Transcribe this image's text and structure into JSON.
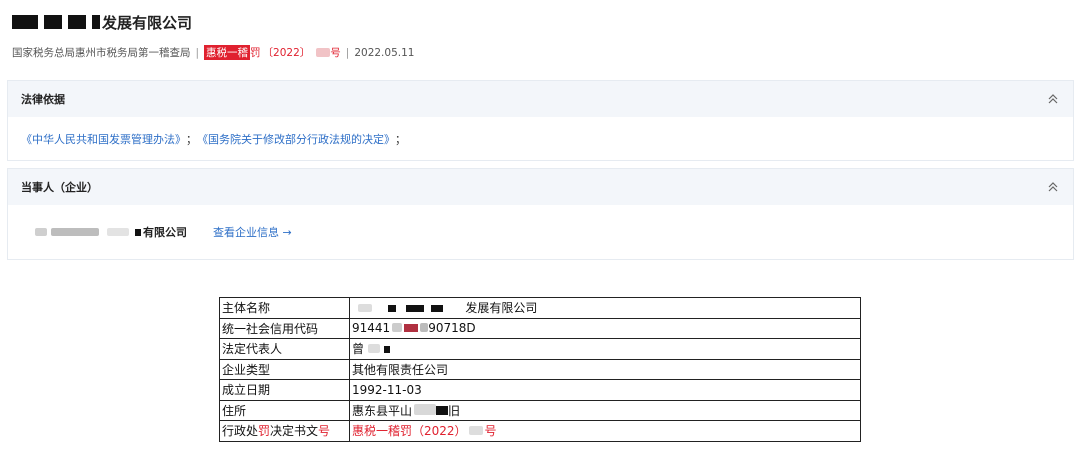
{
  "header": {
    "company_title_suffix": "发展有限公司",
    "authority": "国家税务总局惠州市税务局第一稽查局",
    "doc_prefix_highlight": "惠税一稽",
    "doc_prefix_rest": "罚",
    "doc_year": "〔2022〕",
    "doc_suffix": "号",
    "date": "2022.05.11"
  },
  "legal_basis": {
    "title": "法律依据",
    "law1": "《中华人民共和国发票管理办法》",
    "sep1": "；",
    "law2": "《国务院关于修改部分行政法规的决定》",
    "sep2": "；"
  },
  "party": {
    "title": "当事人（企业）",
    "company_suffix": "有限公司",
    "view_link": "查看企业信息 →"
  },
  "table": {
    "rows": [
      {
        "key": "主体名称",
        "value": "发展有限公司"
      },
      {
        "key": "统一社会信用代码",
        "value_prefix": "91441",
        "value_suffix": "90718D"
      },
      {
        "key": "法定代表人",
        "value": "曾"
      },
      {
        "key": "企业类型",
        "value": "其他有限责任公司"
      },
      {
        "key": "成立日期",
        "value": "1992-11-03"
      },
      {
        "key": "住所",
        "value_prefix": "惠东县平山",
        "value_suffix": "旧"
      },
      {
        "key_prefix": "行政处",
        "key_red": "罚",
        "key_mid": "决定书文",
        "key_red2": "号",
        "value_prefix": "惠税一稽罚（2022）",
        "value_suffix": "号"
      }
    ]
  },
  "colors": {
    "accent": "#2e6fc7",
    "highlight": "#e0212f",
    "section_bg": "#f3f6fa"
  },
  "icons": {
    "collapse": "double-chevron-up-icon",
    "arrow": "arrow-right-icon"
  }
}
